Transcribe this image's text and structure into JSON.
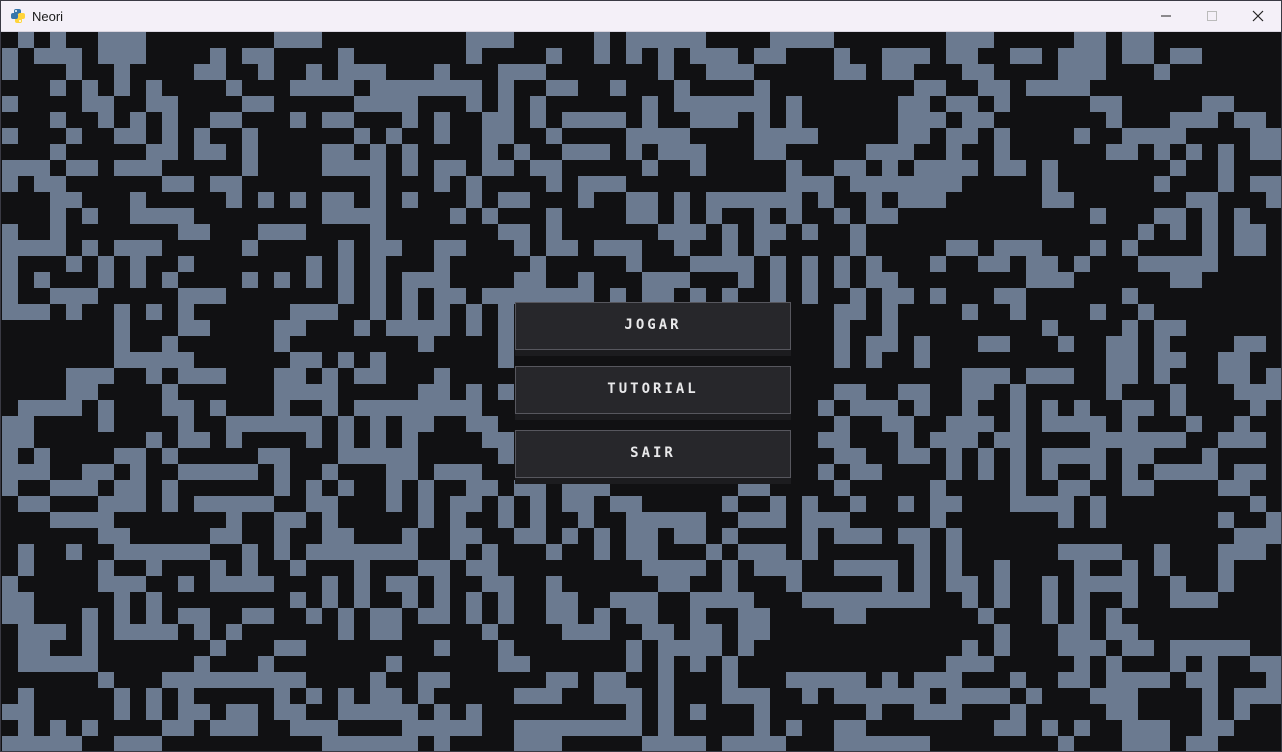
{
  "window": {
    "title": "Neori",
    "icon": "python-snake-icon",
    "controls": [
      "minimize",
      "maximize",
      "close"
    ]
  },
  "menu": {
    "play_label": "JOGAR",
    "tutorial_label": "TUTORIAL",
    "quit_label": "SAIR"
  },
  "colors": {
    "background": "#111113",
    "cell": "#6b7a90",
    "button_face": "#27272b",
    "button_border": "#57575e",
    "button_text": "#e8e8ea"
  }
}
